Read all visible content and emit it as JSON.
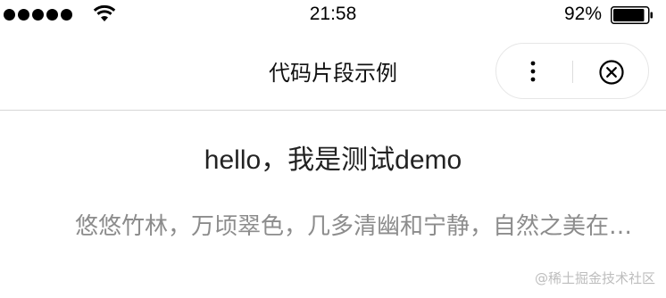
{
  "status_bar": {
    "signal_dots": 5,
    "time": "21:58",
    "battery_percent": "92%",
    "battery_level": 0.92
  },
  "nav_bar": {
    "title": "代码片段示例",
    "capsule_icons": [
      "more-icon",
      "close-icon"
    ]
  },
  "content": {
    "hello": "hello，我是测试demo",
    "poem": "悠悠竹林，万顷翠色，几多清幽和宁静，自然之美在这里展现得淋漓尽致"
  },
  "watermark": "@稀土掘金技术社区",
  "colors": {
    "nav_border": "#d6d6d6",
    "secondary_text": "#8c8c8c",
    "watermark": "#bdbdbd"
  }
}
